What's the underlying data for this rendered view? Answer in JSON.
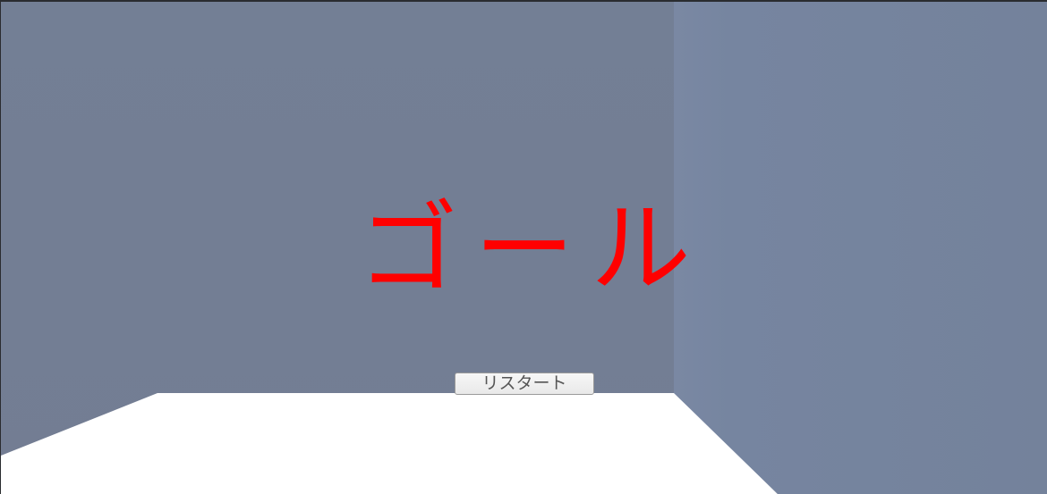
{
  "game": {
    "status_text": "ゴール",
    "restart_label": "リスタート"
  },
  "colors": {
    "back_wall": "#737f94",
    "right_wall": "#7785a0",
    "floor": "#ffffff",
    "goal_text": "#ff0000"
  }
}
